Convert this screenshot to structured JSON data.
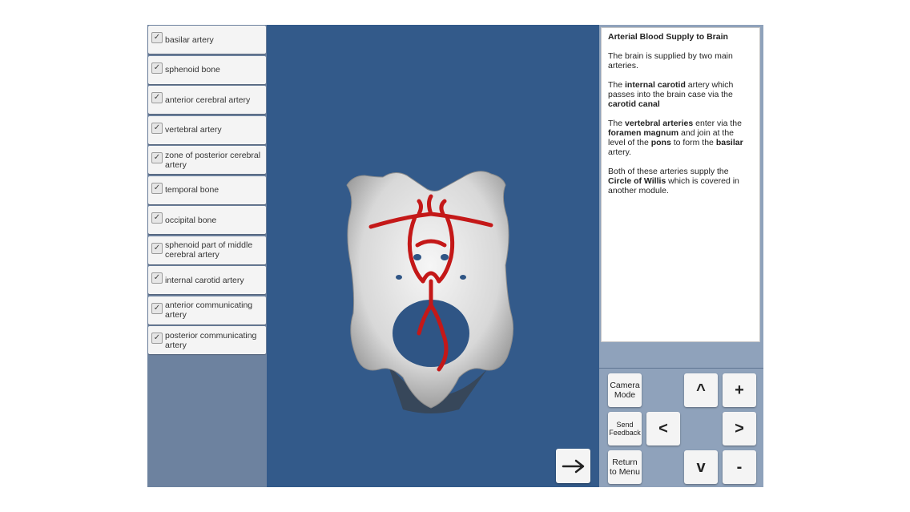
{
  "layers": [
    {
      "label": "basilar artery",
      "checked": true
    },
    {
      "label": "sphenoid bone",
      "checked": true
    },
    {
      "label": "anterior cerebral artery",
      "checked": true
    },
    {
      "label": "vertebral artery",
      "checked": true
    },
    {
      "label": "zone of posterior cerebral artery",
      "checked": true
    },
    {
      "label": "temporal bone",
      "checked": true
    },
    {
      "label": "occipital bone",
      "checked": true
    },
    {
      "label": "sphenoid part of middle cerebral artery",
      "checked": true
    },
    {
      "label": "internal carotid artery",
      "checked": true
    },
    {
      "label": "anterior communicating artery",
      "checked": true
    },
    {
      "label": "posterior communicating artery",
      "checked": true
    }
  ],
  "checkmark": "✓",
  "info": {
    "title": "Arterial Blood Supply to Brain",
    "p1": "The brain is supplied by two main arteries.",
    "p2": {
      "a": "The ",
      "b": "internal carotid",
      "c": " artery which passes into the brain case via the ",
      "d": "carotid canal"
    },
    "p3": {
      "a": "The ",
      "b": "vertebral arteries",
      "c": " enter via the ",
      "d": "foramen magnum",
      "e": " and join at the level of the ",
      "f": "pons",
      "g": " to form the ",
      "h": "basilar",
      "i": " artery."
    },
    "p4": {
      "a": "Both of these arteries supply the ",
      "b": "Circle of Willis",
      "c": " which is covered in another module."
    }
  },
  "controls": {
    "camera_mode": "Camera Mode",
    "send_feedback": "Send Feedback",
    "return_menu": "Return to Menu",
    "up": "^",
    "plus": "+",
    "left": "<",
    "right": ">",
    "down": "v",
    "minus": "-"
  },
  "colors": {
    "background": "#335a8a",
    "panel": "#8fa2bb",
    "sidebar": "#6d829f",
    "artery": "#c41818",
    "bone": "#e2e2e2"
  },
  "icons": {
    "next": "arrow-right-icon"
  }
}
